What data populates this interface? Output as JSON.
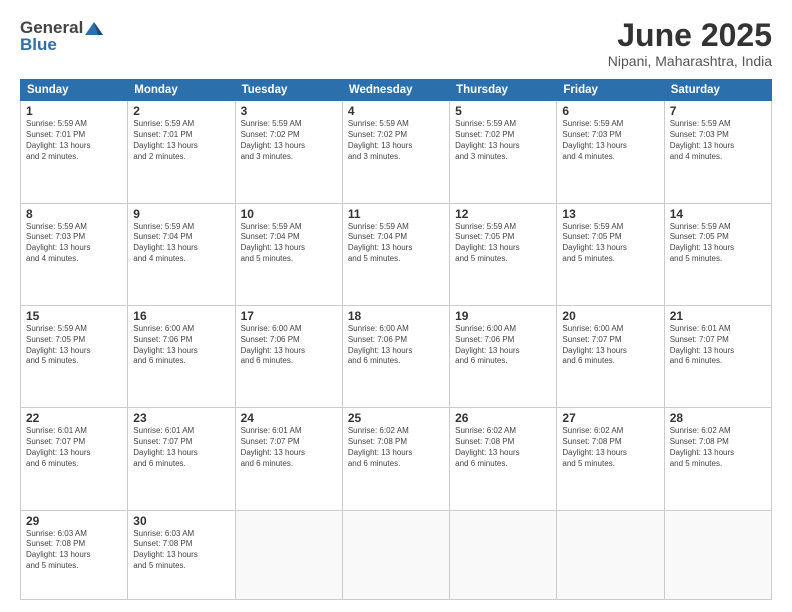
{
  "header": {
    "logo_general": "General",
    "logo_blue": "Blue",
    "title": "June 2025",
    "subtitle": "Nipani, Maharashtra, India"
  },
  "weekdays": [
    "Sunday",
    "Monday",
    "Tuesday",
    "Wednesday",
    "Thursday",
    "Friday",
    "Saturday"
  ],
  "weeks": [
    [
      {
        "day": 1,
        "info": "Sunrise: 5:59 AM\nSunset: 7:01 PM\nDaylight: 13 hours\nand 2 minutes."
      },
      {
        "day": 2,
        "info": "Sunrise: 5:59 AM\nSunset: 7:01 PM\nDaylight: 13 hours\nand 2 minutes."
      },
      {
        "day": 3,
        "info": "Sunrise: 5:59 AM\nSunset: 7:02 PM\nDaylight: 13 hours\nand 3 minutes."
      },
      {
        "day": 4,
        "info": "Sunrise: 5:59 AM\nSunset: 7:02 PM\nDaylight: 13 hours\nand 3 minutes."
      },
      {
        "day": 5,
        "info": "Sunrise: 5:59 AM\nSunset: 7:02 PM\nDaylight: 13 hours\nand 3 minutes."
      },
      {
        "day": 6,
        "info": "Sunrise: 5:59 AM\nSunset: 7:03 PM\nDaylight: 13 hours\nand 4 minutes."
      },
      {
        "day": 7,
        "info": "Sunrise: 5:59 AM\nSunset: 7:03 PM\nDaylight: 13 hours\nand 4 minutes."
      }
    ],
    [
      {
        "day": 8,
        "info": "Sunrise: 5:59 AM\nSunset: 7:03 PM\nDaylight: 13 hours\nand 4 minutes."
      },
      {
        "day": 9,
        "info": "Sunrise: 5:59 AM\nSunset: 7:04 PM\nDaylight: 13 hours\nand 4 minutes."
      },
      {
        "day": 10,
        "info": "Sunrise: 5:59 AM\nSunset: 7:04 PM\nDaylight: 13 hours\nand 5 minutes."
      },
      {
        "day": 11,
        "info": "Sunrise: 5:59 AM\nSunset: 7:04 PM\nDaylight: 13 hours\nand 5 minutes."
      },
      {
        "day": 12,
        "info": "Sunrise: 5:59 AM\nSunset: 7:05 PM\nDaylight: 13 hours\nand 5 minutes."
      },
      {
        "day": 13,
        "info": "Sunrise: 5:59 AM\nSunset: 7:05 PM\nDaylight: 13 hours\nand 5 minutes."
      },
      {
        "day": 14,
        "info": "Sunrise: 5:59 AM\nSunset: 7:05 PM\nDaylight: 13 hours\nand 5 minutes."
      }
    ],
    [
      {
        "day": 15,
        "info": "Sunrise: 5:59 AM\nSunset: 7:05 PM\nDaylight: 13 hours\nand 5 minutes."
      },
      {
        "day": 16,
        "info": "Sunrise: 6:00 AM\nSunset: 7:06 PM\nDaylight: 13 hours\nand 6 minutes."
      },
      {
        "day": 17,
        "info": "Sunrise: 6:00 AM\nSunset: 7:06 PM\nDaylight: 13 hours\nand 6 minutes."
      },
      {
        "day": 18,
        "info": "Sunrise: 6:00 AM\nSunset: 7:06 PM\nDaylight: 13 hours\nand 6 minutes."
      },
      {
        "day": 19,
        "info": "Sunrise: 6:00 AM\nSunset: 7:06 PM\nDaylight: 13 hours\nand 6 minutes."
      },
      {
        "day": 20,
        "info": "Sunrise: 6:00 AM\nSunset: 7:07 PM\nDaylight: 13 hours\nand 6 minutes."
      },
      {
        "day": 21,
        "info": "Sunrise: 6:01 AM\nSunset: 7:07 PM\nDaylight: 13 hours\nand 6 minutes."
      }
    ],
    [
      {
        "day": 22,
        "info": "Sunrise: 6:01 AM\nSunset: 7:07 PM\nDaylight: 13 hours\nand 6 minutes."
      },
      {
        "day": 23,
        "info": "Sunrise: 6:01 AM\nSunset: 7:07 PM\nDaylight: 13 hours\nand 6 minutes."
      },
      {
        "day": 24,
        "info": "Sunrise: 6:01 AM\nSunset: 7:07 PM\nDaylight: 13 hours\nand 6 minutes."
      },
      {
        "day": 25,
        "info": "Sunrise: 6:02 AM\nSunset: 7:08 PM\nDaylight: 13 hours\nand 6 minutes."
      },
      {
        "day": 26,
        "info": "Sunrise: 6:02 AM\nSunset: 7:08 PM\nDaylight: 13 hours\nand 6 minutes."
      },
      {
        "day": 27,
        "info": "Sunrise: 6:02 AM\nSunset: 7:08 PM\nDaylight: 13 hours\nand 5 minutes."
      },
      {
        "day": 28,
        "info": "Sunrise: 6:02 AM\nSunset: 7:08 PM\nDaylight: 13 hours\nand 5 minutes."
      }
    ],
    [
      {
        "day": 29,
        "info": "Sunrise: 6:03 AM\nSunset: 7:08 PM\nDaylight: 13 hours\nand 5 minutes."
      },
      {
        "day": 30,
        "info": "Sunrise: 6:03 AM\nSunset: 7:08 PM\nDaylight: 13 hours\nand 5 minutes."
      },
      null,
      null,
      null,
      null,
      null
    ]
  ]
}
